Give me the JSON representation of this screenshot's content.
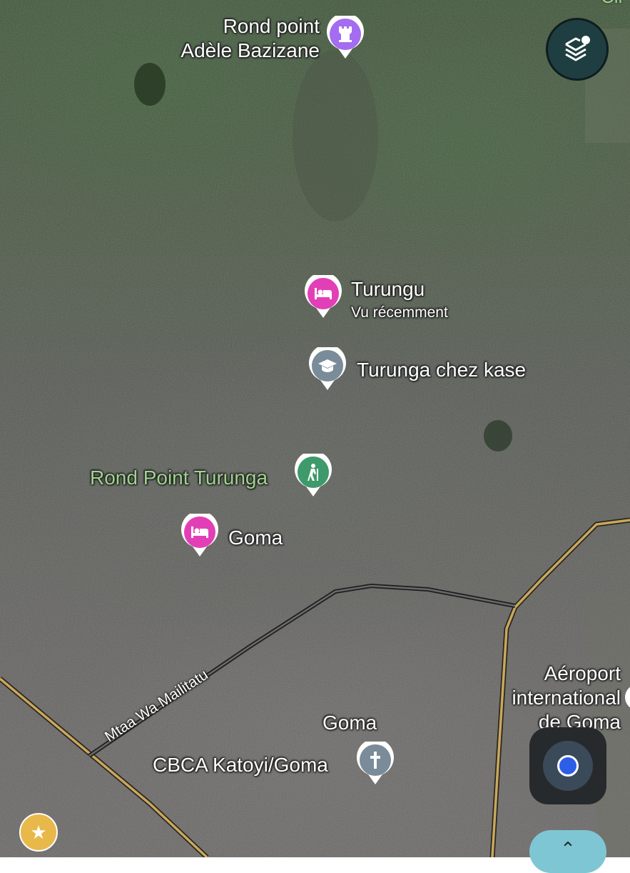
{
  "map": {
    "places": [
      {
        "name": "Rond point\nAdèle Bazizane",
        "line1": "Rond point",
        "line2": "Adèle Bazizane",
        "category": "monument",
        "icon": "tower-icon",
        "color": "#a46cf0"
      },
      {
        "name": "Turungu",
        "subtitle": "Vu récemment",
        "category": "hotel",
        "icon": "bed-icon",
        "color": "#e23fb7"
      },
      {
        "name": "Turunga chez kase",
        "category": "school",
        "icon": "graduation-cap-icon",
        "color": "#7a8c99"
      },
      {
        "name": "Rond Point Turunga",
        "category": "park",
        "icon": "hiking-icon",
        "color": "#3e9a6a"
      },
      {
        "name": "Goma",
        "category": "hotel",
        "icon": "bed-icon",
        "color": "#e23fb7"
      },
      {
        "name": "Goma",
        "category": "city",
        "icon": "",
        "color": ""
      },
      {
        "name": "CBCA Katoyi/Goma",
        "category": "church",
        "icon": "cross-icon",
        "color": "#7a8c99"
      },
      {
        "name": "Aéroport\ninternational\nde Goma",
        "line1": "Aéroport",
        "line2": "international",
        "line3": "de Goma",
        "category": "airport",
        "icon": "",
        "color": ""
      }
    ],
    "roads": [
      {
        "name": "Mtaa Wa Mailitatu",
        "color": "#3b3b3b"
      }
    ],
    "edge_label": "Cir"
  },
  "controls": {
    "layers_icon": "layers-icon",
    "location_icon": "my-location-icon",
    "saved_icon": "star-icon",
    "nav_icon": "chevron-up-icon",
    "accent": "#2d5ee8"
  }
}
